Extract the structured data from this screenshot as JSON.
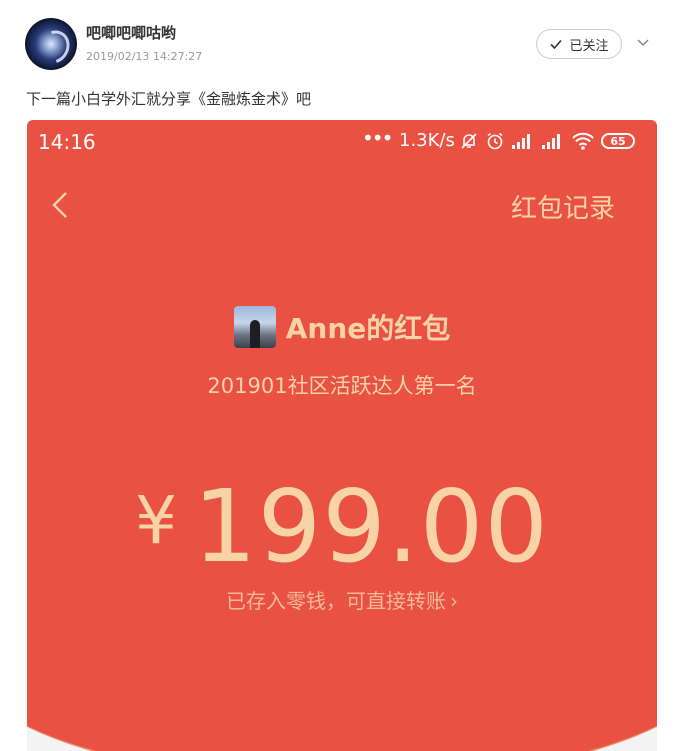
{
  "post": {
    "username": "吧唧吧唧咕哟",
    "timestamp": "2019/02/13 14:27:27",
    "follow_label": "已关注",
    "text": "下一篇小白学外汇就分享《金融炼金术》吧"
  },
  "screenshot": {
    "status_time": "14:16",
    "status_dots": "•••",
    "status_speed": "1.3K/s",
    "battery": "65",
    "records_label": "红包记录",
    "sender_name": "Anne的红包",
    "subtitle": "201901社区活跃达人第一名",
    "currency": "¥",
    "amount": "199.00",
    "deposit_note": "已存入零钱，可直接转账",
    "deposit_chevron": "›"
  },
  "colors": {
    "red_background": "#e95142",
    "gold_text": "#f8d3a5"
  },
  "icons": [
    "check-icon",
    "chevron-down-icon",
    "back-chevron-icon",
    "mute-bell-icon",
    "alarm-icon",
    "signal-icon",
    "wifi-icon",
    "battery-icon"
  ]
}
